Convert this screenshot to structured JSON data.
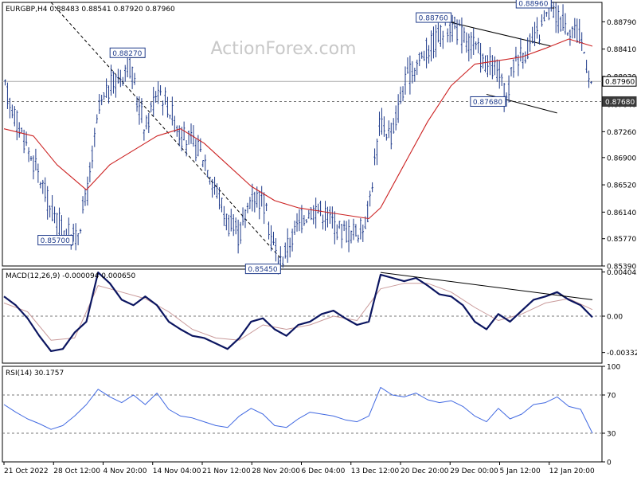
{
  "watermark": "ActionForex.com",
  "colors": {
    "background": "#ffffff",
    "frame": "#000000",
    "price": "#1e3a8a",
    "sma": "#cc2222",
    "macd": "#0b1560",
    "signal": "#c99a9a",
    "rsi": "#4169e1",
    "trendline": "#000000",
    "watermark": "#c8c8c8",
    "current_box": "#ffffff"
  },
  "chart_data": [
    {
      "type": "candlestick",
      "title": "EURGBP,H4  0.88483 0.88541 0.87920 0.87960",
      "ylim": [
        0.8539,
        0.8906
      ],
      "y_ticks": [
        "0.88790",
        "0.88410",
        "0.88030",
        "0.87640",
        "0.87260",
        "0.86900",
        "0.86520",
        "0.86140",
        "0.85770",
        "0.85390"
      ],
      "x_ticks": [
        "21 Oct 2022",
        "28 Oct 12:00",
        "4 Nov 20:00",
        "14 Nov 04:00",
        "21 Nov 12:00",
        "28 Nov 20:00",
        "6 Dec 04:00",
        "13 Dec 12:00",
        "20 Dec 20:00",
        "29 Dec 00:00",
        "5 Jan 12:00",
        "12 Jan 20:00"
      ],
      "price_path": [
        [
          0,
          0.8785
        ],
        [
          0.03,
          0.872
        ],
        [
          0.06,
          0.866
        ],
        [
          0.08,
          0.8612
        ],
        [
          0.1,
          0.859
        ],
        [
          0.12,
          0.8575
        ],
        [
          0.14,
          0.864
        ],
        [
          0.16,
          0.8755
        ],
        [
          0.18,
          0.879
        ],
        [
          0.2,
          0.8805
        ],
        [
          0.21,
          0.8827
        ],
        [
          0.225,
          0.877
        ],
        [
          0.24,
          0.873
        ],
        [
          0.26,
          0.879
        ],
        [
          0.28,
          0.876
        ],
        [
          0.3,
          0.872
        ],
        [
          0.32,
          0.871
        ],
        [
          0.34,
          0.869
        ],
        [
          0.36,
          0.8645
        ],
        [
          0.38,
          0.86
        ],
        [
          0.4,
          0.858
        ],
        [
          0.42,
          0.864
        ],
        [
          0.44,
          0.863
        ],
        [
          0.46,
          0.856
        ],
        [
          0.47,
          0.8545
        ],
        [
          0.49,
          0.858
        ],
        [
          0.51,
          0.861
        ],
        [
          0.53,
          0.862
        ],
        [
          0.55,
          0.861
        ],
        [
          0.57,
          0.859
        ],
        [
          0.59,
          0.8585
        ],
        [
          0.61,
          0.859
        ],
        [
          0.62,
          0.862
        ],
        [
          0.64,
          0.874
        ],
        [
          0.66,
          0.872
        ],
        [
          0.68,
          0.879
        ],
        [
          0.7,
          0.882
        ],
        [
          0.72,
          0.884
        ],
        [
          0.74,
          0.886
        ],
        [
          0.76,
          0.8876
        ],
        [
          0.78,
          0.886
        ],
        [
          0.8,
          0.8845
        ],
        [
          0.82,
          0.882
        ],
        [
          0.84,
          0.881
        ],
        [
          0.855,
          0.8768
        ],
        [
          0.87,
          0.883
        ],
        [
          0.89,
          0.884
        ],
        [
          0.91,
          0.886
        ],
        [
          0.93,
          0.8896
        ],
        [
          0.95,
          0.888
        ],
        [
          0.97,
          0.887
        ],
        [
          0.985,
          0.8848
        ],
        [
          1.0,
          0.8796
        ]
      ],
      "sma_path": [
        [
          0,
          0.873
        ],
        [
          0.05,
          0.872
        ],
        [
          0.09,
          0.868
        ],
        [
          0.14,
          0.8645
        ],
        [
          0.18,
          0.868
        ],
        [
          0.22,
          0.87
        ],
        [
          0.26,
          0.872
        ],
        [
          0.3,
          0.873
        ],
        [
          0.34,
          0.871
        ],
        [
          0.38,
          0.868
        ],
        [
          0.42,
          0.865
        ],
        [
          0.46,
          0.863
        ],
        [
          0.5,
          0.862
        ],
        [
          0.54,
          0.8615
        ],
        [
          0.58,
          0.861
        ],
        [
          0.62,
          0.8605
        ],
        [
          0.64,
          0.862
        ],
        [
          0.68,
          0.868
        ],
        [
          0.72,
          0.874
        ],
        [
          0.76,
          0.879
        ],
        [
          0.8,
          0.882
        ],
        [
          0.84,
          0.8825
        ],
        [
          0.88,
          0.883
        ],
        [
          0.92,
          0.8842
        ],
        [
          0.96,
          0.8855
        ],
        [
          1.0,
          0.8845
        ]
      ],
      "levels": [
        {
          "y": 0.8796,
          "style": "solid",
          "label": "0.87960"
        },
        {
          "y": 0.8768,
          "style": "dashed",
          "label": "0.87680"
        }
      ],
      "trendlines": [
        {
          "from": [
            0.08,
            0.8906
          ],
          "to": [
            0.47,
            0.855
          ],
          "style": "dashed"
        },
        {
          "from": [
            0.76,
            0.8878
          ],
          "to": [
            0.93,
            0.8845
          ],
          "style": "solid"
        },
        {
          "from": [
            0.82,
            0.8778
          ],
          "to": [
            0.94,
            0.8752
          ],
          "style": "solid"
        }
      ],
      "annotations": [
        {
          "x": 0.21,
          "y": 0.8827,
          "label": "0.88270",
          "pos": "above"
        },
        {
          "x": 0.12,
          "y": 0.8575,
          "label": "0.85700",
          "pos": "left"
        },
        {
          "x": 0.47,
          "y": 0.8545,
          "label": "0.85450",
          "pos": "below"
        },
        {
          "x": 0.76,
          "y": 0.8876,
          "label": "0.88760",
          "pos": "above-left"
        },
        {
          "x": 0.93,
          "y": 0.8896,
          "label": "0.88960",
          "pos": "above-left"
        },
        {
          "x": 0.855,
          "y": 0.8768,
          "label": "0.87680",
          "pos": "left"
        }
      ]
    },
    {
      "type": "line",
      "title": "MACD(12,26,9) -0.000094 0.000650",
      "ylim": [
        -0.0043,
        0.0043
      ],
      "y_ticks": [
        "0.004042",
        "0.00",
        "-0.003326"
      ],
      "macd_path": [
        [
          0,
          0.0018
        ],
        [
          0.02,
          0.001
        ],
        [
          0.04,
          -0.0002
        ],
        [
          0.06,
          -0.0018
        ],
        [
          0.08,
          -0.0032
        ],
        [
          0.1,
          -0.003
        ],
        [
          0.12,
          -0.0015
        ],
        [
          0.14,
          -0.0005
        ],
        [
          0.16,
          0.004
        ],
        [
          0.18,
          0.003
        ],
        [
          0.2,
          0.0015
        ],
        [
          0.22,
          0.001
        ],
        [
          0.24,
          0.0018
        ],
        [
          0.26,
          0.001
        ],
        [
          0.28,
          -0.0005
        ],
        [
          0.3,
          -0.0012
        ],
        [
          0.32,
          -0.0018
        ],
        [
          0.34,
          -0.002
        ],
        [
          0.36,
          -0.0025
        ],
        [
          0.38,
          -0.003
        ],
        [
          0.4,
          -0.002
        ],
        [
          0.42,
          -0.0005
        ],
        [
          0.44,
          -0.0002
        ],
        [
          0.46,
          -0.0012
        ],
        [
          0.48,
          -0.0018
        ],
        [
          0.5,
          -0.0008
        ],
        [
          0.52,
          -0.0005
        ],
        [
          0.54,
          0.0002
        ],
        [
          0.56,
          0.0005
        ],
        [
          0.58,
          -0.0002
        ],
        [
          0.6,
          -0.0008
        ],
        [
          0.62,
          -0.0005
        ],
        [
          0.64,
          0.0038
        ],
        [
          0.66,
          0.0035
        ],
        [
          0.68,
          0.0032
        ],
        [
          0.7,
          0.0035
        ],
        [
          0.72,
          0.0028
        ],
        [
          0.74,
          0.002
        ],
        [
          0.76,
          0.0018
        ],
        [
          0.78,
          0.001
        ],
        [
          0.8,
          -0.0005
        ],
        [
          0.82,
          -0.0012
        ],
        [
          0.84,
          0.0002
        ],
        [
          0.86,
          -0.0005
        ],
        [
          0.88,
          0.0005
        ],
        [
          0.9,
          0.0015
        ],
        [
          0.92,
          0.0018
        ],
        [
          0.94,
          0.0022
        ],
        [
          0.96,
          0.0015
        ],
        [
          0.98,
          0.001
        ],
        [
          1.0,
          -0.0001
        ]
      ],
      "signal_path": [
        [
          0,
          0.0012
        ],
        [
          0.04,
          0.0004
        ],
        [
          0.08,
          -0.0022
        ],
        [
          0.12,
          -0.002
        ],
        [
          0.16,
          0.0028
        ],
        [
          0.2,
          0.0022
        ],
        [
          0.24,
          0.0016
        ],
        [
          0.28,
          0.0004
        ],
        [
          0.32,
          -0.0012
        ],
        [
          0.36,
          -0.002
        ],
        [
          0.4,
          -0.0022
        ],
        [
          0.44,
          -0.0008
        ],
        [
          0.48,
          -0.0012
        ],
        [
          0.52,
          -0.0008
        ],
        [
          0.56,
          0.0
        ],
        [
          0.6,
          -0.0004
        ],
        [
          0.64,
          0.0025
        ],
        [
          0.68,
          0.003
        ],
        [
          0.72,
          0.003
        ],
        [
          0.76,
          0.0022
        ],
        [
          0.8,
          0.0008
        ],
        [
          0.84,
          -0.0004
        ],
        [
          0.88,
          0.0002
        ],
        [
          0.92,
          0.0012
        ],
        [
          0.96,
          0.0016
        ],
        [
          1.0,
          0.0006
        ]
      ],
      "trendlines": [
        {
          "from": [
            0.64,
            0.004
          ],
          "to": [
            1.0,
            0.0015
          ],
          "style": "solid"
        }
      ],
      "levels": [
        {
          "y": 0,
          "style": "dashed"
        }
      ]
    },
    {
      "type": "line",
      "title": "RSI(14) 30.1757",
      "ylim": [
        0,
        100
      ],
      "y_ticks": [
        "100",
        "70",
        "30",
        "0"
      ],
      "rsi_path": [
        [
          0,
          60
        ],
        [
          0.02,
          52
        ],
        [
          0.04,
          45
        ],
        [
          0.06,
          40
        ],
        [
          0.08,
          34
        ],
        [
          0.1,
          38
        ],
        [
          0.12,
          48
        ],
        [
          0.14,
          60
        ],
        [
          0.16,
          76
        ],
        [
          0.18,
          68
        ],
        [
          0.2,
          62
        ],
        [
          0.22,
          70
        ],
        [
          0.24,
          60
        ],
        [
          0.26,
          72
        ],
        [
          0.28,
          55
        ],
        [
          0.3,
          48
        ],
        [
          0.32,
          46
        ],
        [
          0.34,
          42
        ],
        [
          0.36,
          38
        ],
        [
          0.38,
          36
        ],
        [
          0.4,
          48
        ],
        [
          0.42,
          56
        ],
        [
          0.44,
          50
        ],
        [
          0.46,
          38
        ],
        [
          0.48,
          36
        ],
        [
          0.5,
          45
        ],
        [
          0.52,
          52
        ],
        [
          0.54,
          50
        ],
        [
          0.56,
          48
        ],
        [
          0.58,
          44
        ],
        [
          0.6,
          42
        ],
        [
          0.62,
          48
        ],
        [
          0.64,
          78
        ],
        [
          0.66,
          70
        ],
        [
          0.68,
          68
        ],
        [
          0.7,
          72
        ],
        [
          0.72,
          65
        ],
        [
          0.74,
          62
        ],
        [
          0.76,
          64
        ],
        [
          0.78,
          58
        ],
        [
          0.8,
          48
        ],
        [
          0.82,
          42
        ],
        [
          0.84,
          56
        ],
        [
          0.86,
          45
        ],
        [
          0.88,
          50
        ],
        [
          0.9,
          60
        ],
        [
          0.92,
          62
        ],
        [
          0.94,
          68
        ],
        [
          0.96,
          58
        ],
        [
          0.98,
          55
        ],
        [
          1.0,
          30
        ]
      ],
      "levels": [
        {
          "y": 70,
          "style": "dashed"
        },
        {
          "y": 30,
          "style": "dashed"
        }
      ]
    }
  ]
}
